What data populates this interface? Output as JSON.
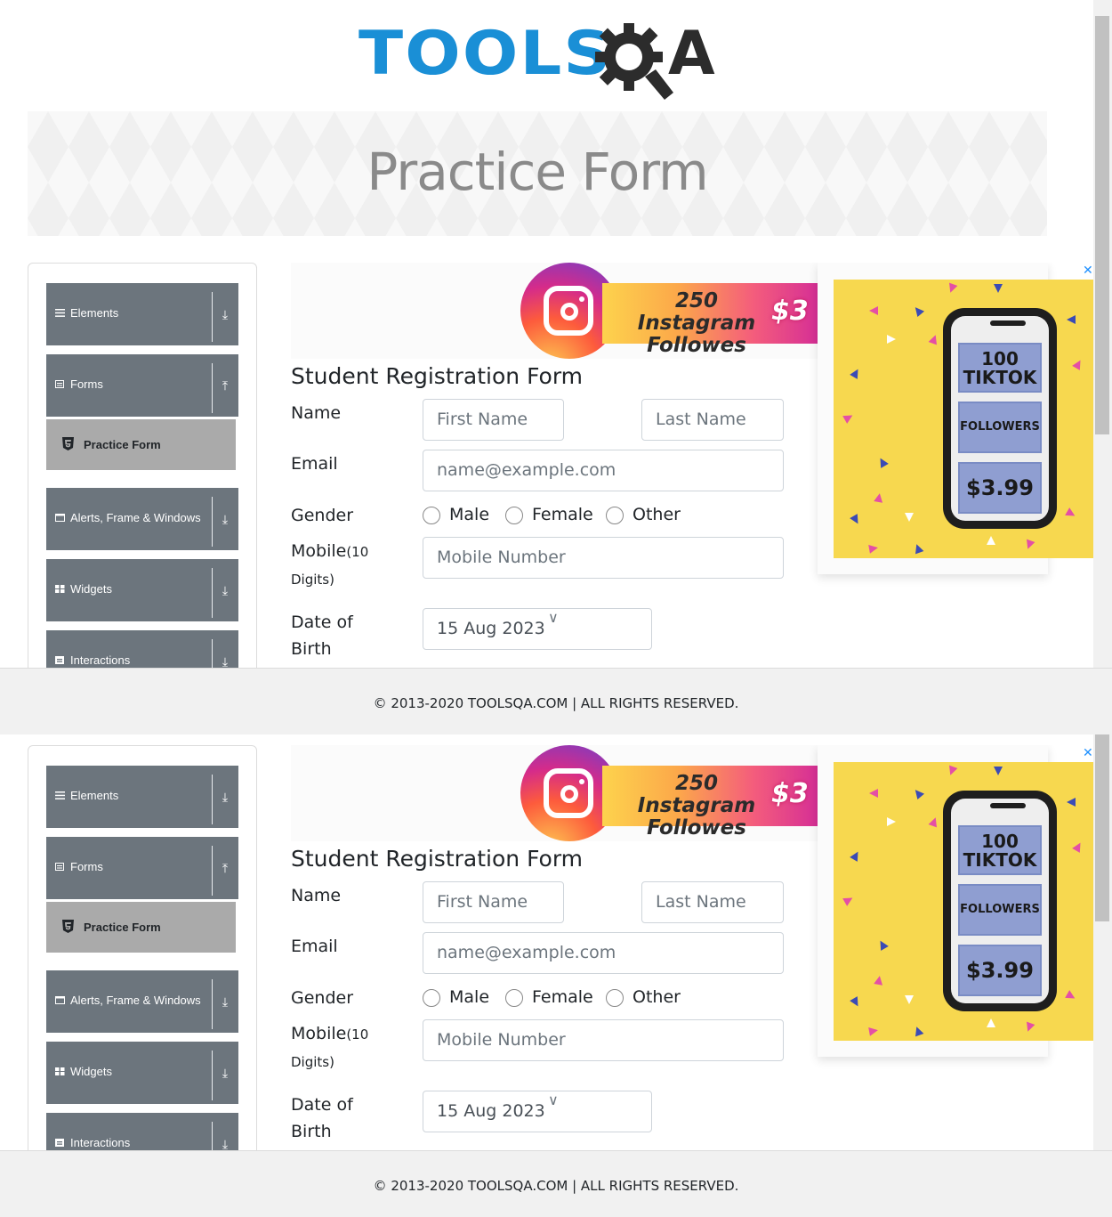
{
  "header": {
    "logo_main": "TOOLS",
    "logo_end": "A",
    "page_title": "Practice Form"
  },
  "sidebar": {
    "groups": [
      {
        "label": "Elements",
        "arrow": "⤓"
      },
      {
        "label": "Forms",
        "arrow": "⤒"
      },
      {
        "label": "Alerts, Frame & Windows",
        "arrow": "⤓"
      },
      {
        "label": "Widgets",
        "arrow": "⤓"
      },
      {
        "label": "Interactions",
        "arrow": "⤓"
      }
    ],
    "active_item": "Practice Form"
  },
  "ad_strip": {
    "text": "250 Instagram Followes",
    "price": "$3"
  },
  "form": {
    "title": "Student Registration Form",
    "name_label": "Name",
    "first_name_placeholder": "First Name",
    "last_name_placeholder": "Last Name",
    "email_label": "Email",
    "email_placeholder": "name@example.com",
    "gender_label": "Gender",
    "gender_options": [
      "Male",
      "Female",
      "Other"
    ],
    "mobile_label": "Mobile",
    "mobile_hint_a": "(10",
    "mobile_hint_b": "Digits)",
    "mobile_placeholder": "Mobile Number",
    "dob_label_a": "Date of",
    "dob_label_b": "Birth",
    "dob_value": "15 Aug 2023"
  },
  "side_ad": {
    "line1": "100",
    "line2": "TIKTOK",
    "line3": "FOLLOWERS",
    "price": "$3.99",
    "close": "✕"
  },
  "footer": {
    "text": "© 2013-2020 TOOLSQA.COM | ALL RIGHTS RESERVED."
  },
  "colors": {
    "brand_blue": "#1a8fd6",
    "sidebar_group": "#6c757d",
    "sidebar_active": "#aaaaaa",
    "ad_yellow": "#f7d84f"
  }
}
